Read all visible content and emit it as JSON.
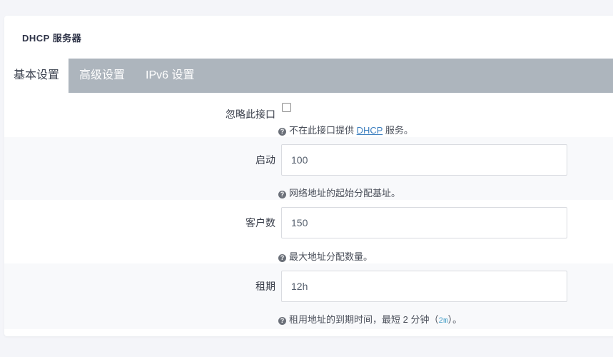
{
  "panel": {
    "title": "DHCP 服务器"
  },
  "tabs": [
    {
      "label": "基本设置",
      "active": true
    },
    {
      "label": "高级设置",
      "active": false
    },
    {
      "label": "IPv6 设置",
      "active": false
    }
  ],
  "fields": {
    "ignore": {
      "label": "忽略此接口",
      "checked": false,
      "help_before": "不在此接口提供",
      "help_link": "DHCP",
      "help_after": "服务。"
    },
    "start": {
      "label": "启动",
      "value": "100",
      "help": "网络地址的起始分配基址。"
    },
    "limit": {
      "label": "客户数",
      "value": "150",
      "help": "最大地址分配数量。"
    },
    "leasetime": {
      "label": "租期",
      "value": "12h",
      "help_before": "租用地址的到期时间，最短 2 分钟（",
      "help_code": "2m",
      "help_after": "）。"
    }
  },
  "colors": {
    "tabbar": "#adb5bd",
    "link": "#3d7fbf"
  }
}
